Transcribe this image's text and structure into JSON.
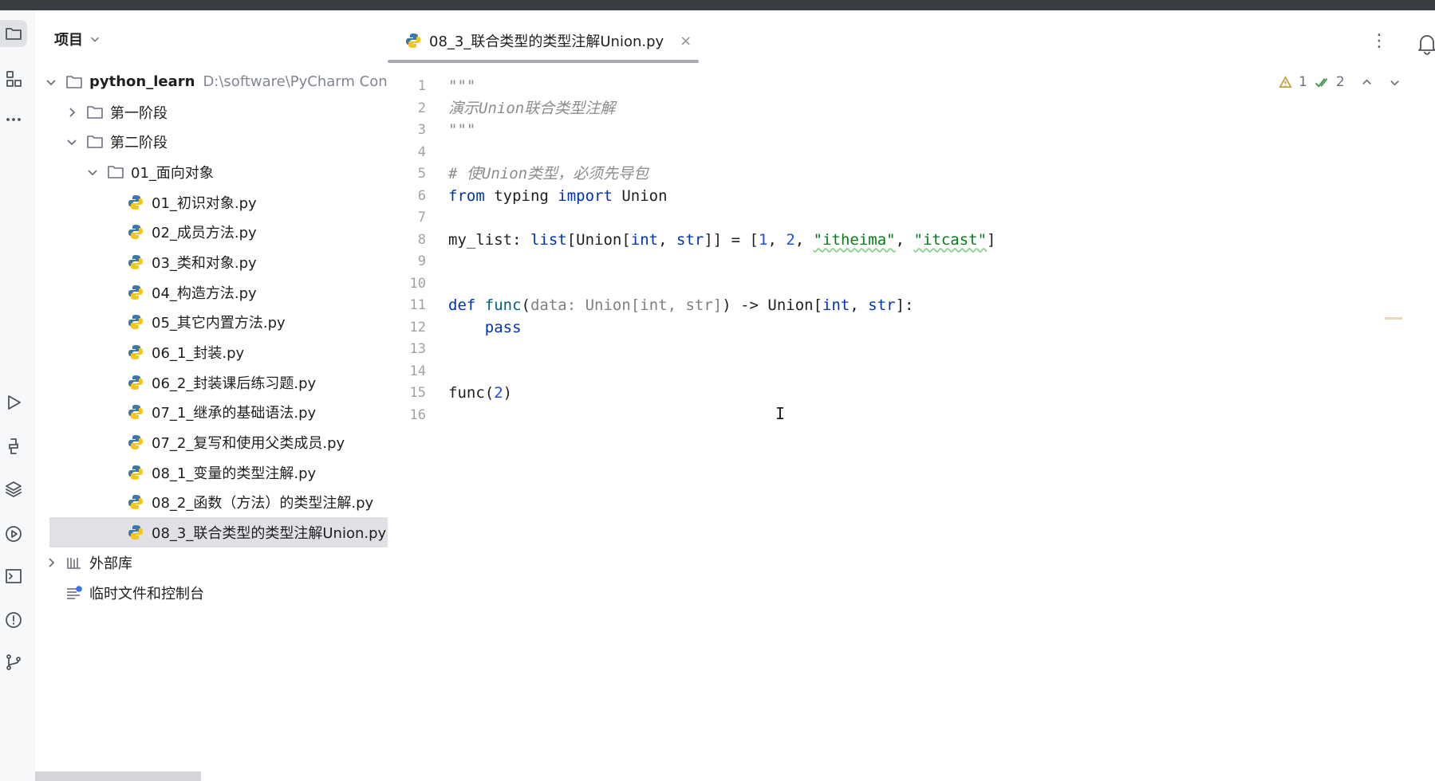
{
  "panel": {
    "title": "项目",
    "root": {
      "name": "python_learn",
      "path": "D:\\software\\PyCharm Con"
    },
    "stage1": "第一阶段",
    "stage2": "第二阶段",
    "folder_oop": "01_面向对象",
    "files": [
      "01_初识对象.py",
      "02_成员方法.py",
      "03_类和对象.py",
      "04_构造方法.py",
      "05_其它内置方法.py",
      "06_1_封装.py",
      "06_2_封装课后练习题.py",
      "07_1_继承的基础语法.py",
      "07_2_复写和使用父类成员.py",
      "08_1_变量的类型注解.py",
      "08_2_函数（方法）的类型注解.py",
      "08_3_联合类型的类型注解Union.py"
    ],
    "external_libs": "外部库",
    "scratches": "临时文件和控制台"
  },
  "editor": {
    "tab_label": "08_3_联合类型的类型注解Union.py",
    "tab_close": "×",
    "more": "⋮",
    "warnings": "1",
    "checks": "2",
    "line_numbers": [
      "1",
      "2",
      "3",
      "4",
      "5",
      "6",
      "7",
      "8",
      "9",
      "10",
      "11",
      "12",
      "13",
      "14",
      "15",
      "16"
    ],
    "code": {
      "l1": "\"\"\"",
      "l2": "演示Union联合类型注解",
      "l3": "\"\"\"",
      "l5": "# 使Union类型，必须先导包",
      "l6_kw1": "from",
      "l6_mod": " typing ",
      "l6_kw2": "import",
      "l6_name": " Union",
      "l8_a": "my_list: ",
      "l8_b": "list",
      "l8_c": "[Union[",
      "l8_d": "int",
      "l8_e": ", ",
      "l8_f": "str",
      "l8_g": "]] = [",
      "l8_n1": "1",
      "l8_h": ", ",
      "l8_n2": "2",
      "l8_i": ", ",
      "l8_s1": "\"itheima\"",
      "l8_j": ", ",
      "l8_s2": "\"itcast\"",
      "l8_k": "]",
      "l11_kw": "def",
      "l11_fn": " func",
      "l11_a": "(",
      "l11_param": "data: Union[int, str]",
      "l11_b": ") -> Union[",
      "l11_int": "int",
      "l11_c": ", ",
      "l11_str": "str",
      "l11_d": "]:",
      "l12_kw": "    pass",
      "l15_a": "func(",
      "l15_n": "2",
      "l15_b": ")"
    },
    "caret": "I"
  }
}
